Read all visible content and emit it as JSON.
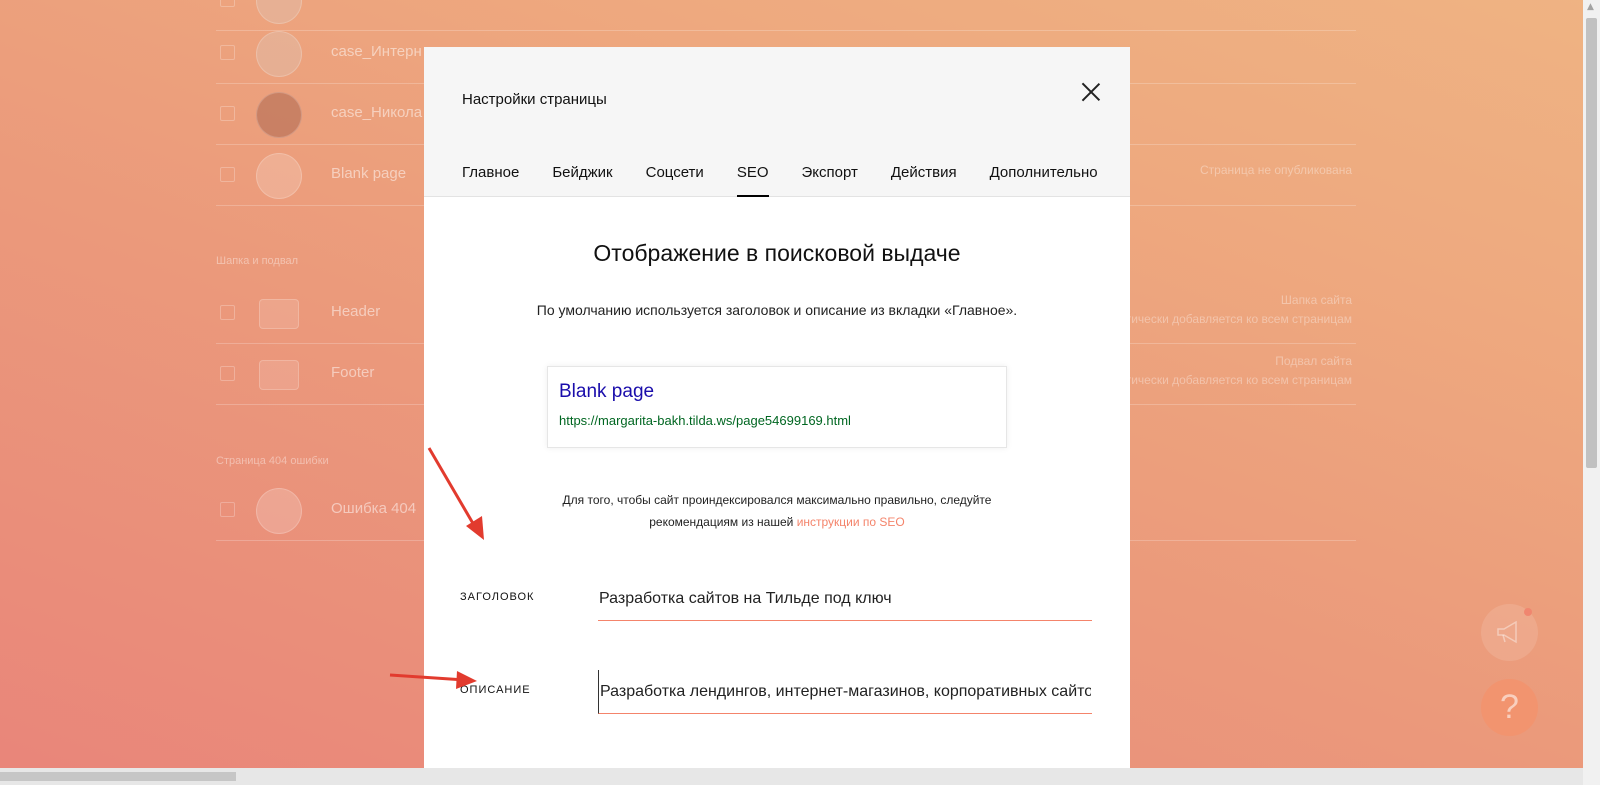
{
  "background": {
    "pages": [
      {
        "title": "case_Интерн",
        "status": ""
      },
      {
        "title": "case_Никола",
        "status": ""
      },
      {
        "title": "Blank page",
        "status": "Страница не опубликована"
      }
    ],
    "section_header": "Шапка и подвал",
    "header_footer": [
      {
        "title": "Header",
        "status_line1": "Шапка сайта",
        "status_line2": "тически добавляется ко всем страницам"
      },
      {
        "title": "Footer",
        "status_line1": "Подвал сайта",
        "status_line2": "тически добавляется ко всем страницам"
      }
    ],
    "section_404": "Страница 404 ошибки",
    "error_page": {
      "title": "Ошибка 404"
    }
  },
  "fab": {
    "help_label": "?"
  },
  "modal": {
    "title": "Настройки страницы",
    "tabs": [
      {
        "label": "Главное"
      },
      {
        "label": "Бейджик"
      },
      {
        "label": "Соцсети"
      },
      {
        "label": "SEO"
      },
      {
        "label": "Экспорт"
      },
      {
        "label": "Действия"
      },
      {
        "label": "Дополнительно"
      }
    ],
    "active_tab": "SEO",
    "seo": {
      "heading": "Отображение в поисковой выдаче",
      "subheading": "По умолчанию используется заголовок и описание из вкладки «Главное».",
      "preview": {
        "title": "Blank page",
        "url": "https://margarita-bakh.tilda.ws/page54699169.html"
      },
      "hint_line1": "Для того, чтобы сайт проиндексировался максимально правильно, следуйте",
      "hint_line2_prefix": "рекомендациям из нашей ",
      "hint_link": "инструкции по SEO",
      "fields": {
        "title_label": "Заголовок",
        "title_value": "Разработка сайтов на Тильде под ключ",
        "description_label": "Описание",
        "description_value": "Разработка лендингов, интернет-магазинов, корпоративных сайтов"
      }
    }
  },
  "colors": {
    "accent": "#f4846b",
    "link_blue": "#1a0dab",
    "url_green": "#006621",
    "arrow_red": "#e23b2e"
  }
}
